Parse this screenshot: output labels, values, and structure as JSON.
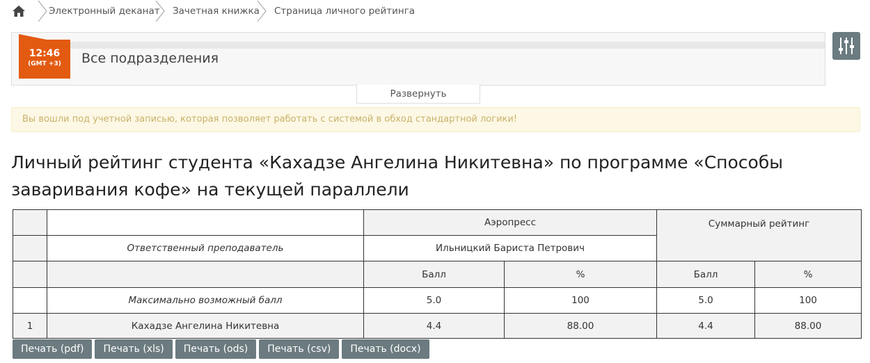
{
  "breadcrumb": {
    "home_icon": "home-icon",
    "items": [
      "Электронный деканат",
      "Зачетная книжка",
      "Страница личного рейтинга"
    ]
  },
  "header": {
    "clock_time": "12:46",
    "clock_tz": "(GMT +3)",
    "title": "Все подразделения",
    "expand_label": "Развернуть",
    "settings_icon": "sliders-icon"
  },
  "alert": {
    "text": "Вы вошли под учетной записью, которая позволяет работать с системой в обход стандартной логики!"
  },
  "page": {
    "heading": "Личный рейтинг студента «Кахадзе Ангелина Никитевна» по программе «Способы заваривания кофе» на текущей параллели"
  },
  "table": {
    "subject": "Аэропресс",
    "total_header": "Суммарный рейтинг",
    "teacher_label": "Ответственный преподаватель",
    "teacher_name": "Ильницкий Бариста Петрович",
    "col_score": "Балл",
    "col_percent": "%",
    "max_row": {
      "label": "Максимально возможный балл",
      "score": "5.0",
      "percent": "100",
      "total_score": "5.0",
      "total_percent": "100"
    },
    "rows": [
      {
        "num": "1",
        "name": "Кахадзе Ангелина Никитевна",
        "score": "4.4",
        "percent": "88.00",
        "total_score": "4.4",
        "total_percent": "88.00"
      }
    ]
  },
  "buttons": {
    "pdf": "Печать (pdf)",
    "xls": "Печать (xls)",
    "ods": "Печать (ods)",
    "csv": "Печать (csv)",
    "docx": "Печать (docx)"
  },
  "colors": {
    "accent": "#e35a11",
    "button": "#6b7b80",
    "alert_bg": "#fdf8e5",
    "alert_text": "#c8b16a"
  }
}
